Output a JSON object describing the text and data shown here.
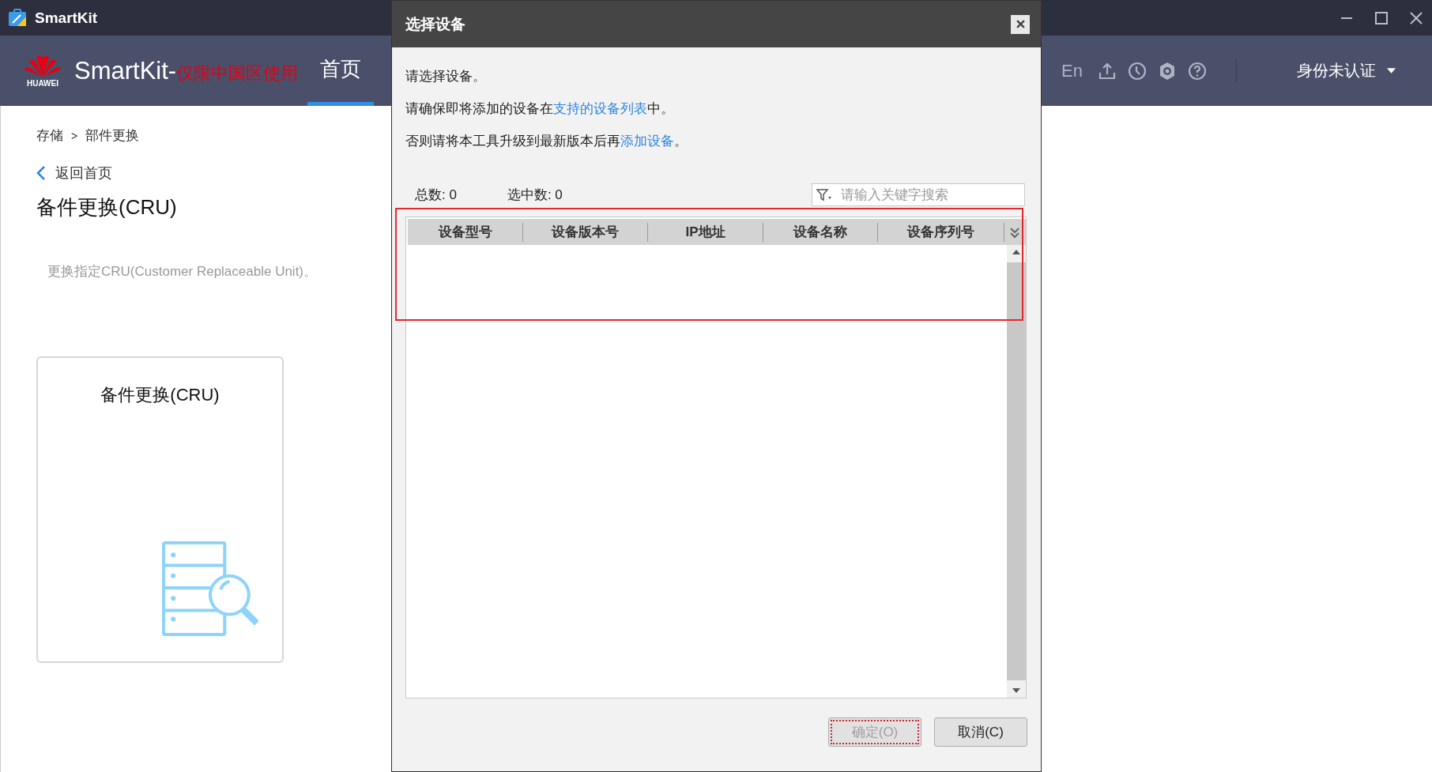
{
  "window": {
    "title": "SmartKit"
  },
  "header": {
    "logo_text": "HUAWEI",
    "brand": "SmartKit-",
    "brand_note": "仅限中国区使用",
    "tabs": [
      {
        "label": "首页",
        "selected": true
      }
    ],
    "language": "En",
    "user": "身份未认证"
  },
  "breadcrumb": [
    "存储",
    "部件更换"
  ],
  "breadcrumb_separator": ">",
  "back_link": "返回首页",
  "page_title": "备件更换(CRU)",
  "description": "更换指定CRU(Customer Replaceable Unit)。",
  "cards": [
    {
      "title": "备件更换(CRU)"
    }
  ],
  "dialog": {
    "title": "选择设备",
    "lines": [
      [
        {
          "kind": "text",
          "text": "请选择设备。"
        }
      ],
      [
        {
          "kind": "text",
          "text": "请确保即将添加的设备在"
        },
        {
          "kind": "link",
          "text": "支持的设备列表"
        },
        {
          "kind": "text",
          "text": "中。"
        }
      ],
      [
        {
          "kind": "text",
          "text": "否则请将本工具升级到最新版本后再"
        },
        {
          "kind": "link",
          "text": "添加设备"
        },
        {
          "kind": "text",
          "text": "。"
        }
      ]
    ],
    "total": "总数: 0",
    "selected_count": "选中数: 0",
    "search": {
      "placeholder": "请输入关键字搜索"
    },
    "columns": [
      "设备型号",
      "设备版本号",
      "IP地址",
      "设备名称",
      "设备序列号"
    ],
    "highlighted": true,
    "buttons": [
      {
        "label": "确定(O)",
        "disabled": true,
        "focused": true
      },
      {
        "label": "取消(C)",
        "disabled": false,
        "focused": false
      }
    ]
  }
}
